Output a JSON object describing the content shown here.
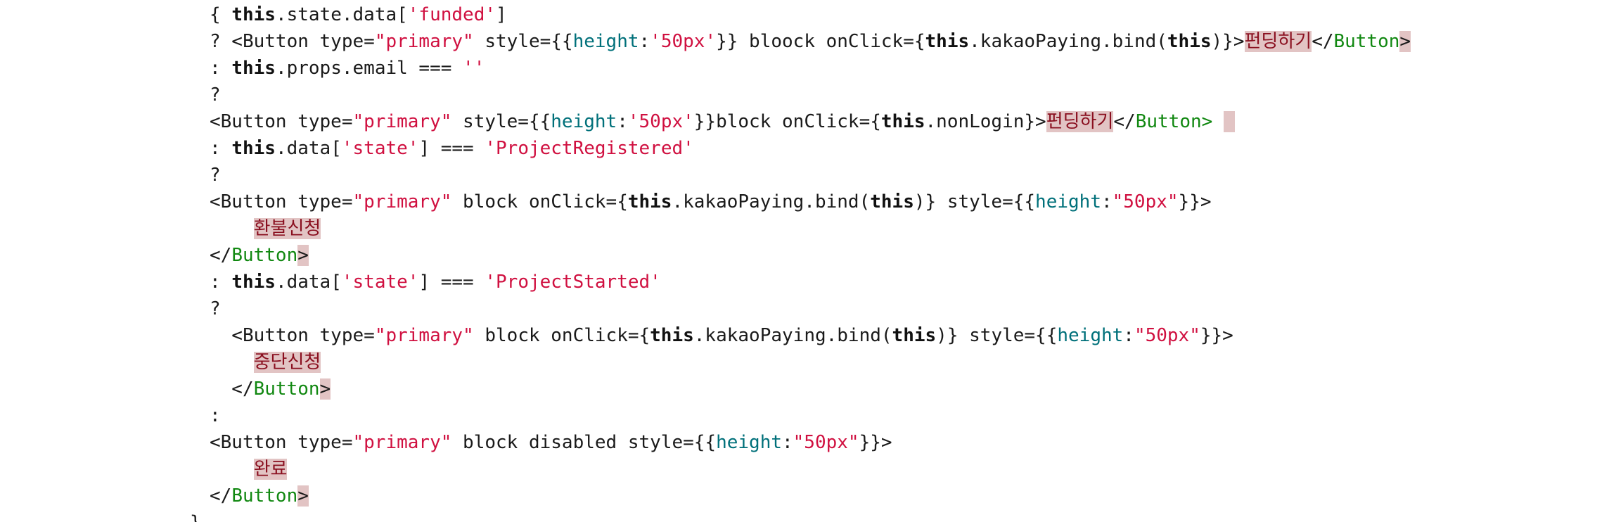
{
  "editor": {
    "colors": {
      "background": "#ffffff",
      "text": "#1a1a1a",
      "keyword": "#111111",
      "string": "#d01040",
      "attribute": "#00707a",
      "jsx_tag": "#118811",
      "highlight": "#e2c4c4"
    },
    "lines": [
      [
        {
          "t": "{ ",
          "c": "plain"
        },
        {
          "t": "this",
          "c": "kw"
        },
        {
          "t": ".state.data[",
          "c": "plain"
        },
        {
          "t": "'funded'",
          "c": "str"
        },
        {
          "t": "]",
          "c": "plain"
        }
      ],
      [
        {
          "t": "? <Button type=",
          "c": "plain"
        },
        {
          "t": "\"primary\"",
          "c": "str"
        },
        {
          "t": " style={{",
          "c": "plain"
        },
        {
          "t": "height",
          "c": "attr"
        },
        {
          "t": ":",
          "c": "plain"
        },
        {
          "t": "'50px'",
          "c": "str"
        },
        {
          "t": "}} bloock onClick={",
          "c": "plain"
        },
        {
          "t": "this",
          "c": "kw"
        },
        {
          "t": ".kakaoPaying.bind(",
          "c": "plain"
        },
        {
          "t": "this",
          "c": "kw"
        },
        {
          "t": ")}>",
          "c": "plain"
        },
        {
          "t": "펀딩하기",
          "c": "hl"
        },
        {
          "t": "</",
          "c": "plain"
        },
        {
          "t": "Button",
          "c": "tag"
        },
        {
          "t": ">",
          "c": "hl-plain"
        }
      ],
      [
        {
          "t": ": ",
          "c": "plain"
        },
        {
          "t": "this",
          "c": "kw"
        },
        {
          "t": ".props.email === ",
          "c": "plain"
        },
        {
          "t": "''",
          "c": "str"
        }
      ],
      [
        {
          "t": "?",
          "c": "plain"
        }
      ],
      [
        {
          "t": "<Button type=",
          "c": "plain"
        },
        {
          "t": "\"primary\"",
          "c": "str"
        },
        {
          "t": " style={{",
          "c": "plain"
        },
        {
          "t": "height",
          "c": "attr"
        },
        {
          "t": ":",
          "c": "plain"
        },
        {
          "t": "'50px'",
          "c": "str"
        },
        {
          "t": "}}block onClick={",
          "c": "plain"
        },
        {
          "t": "this",
          "c": "kw"
        },
        {
          "t": ".nonLogin}>",
          "c": "plain"
        },
        {
          "t": "펀딩하기",
          "c": "hl"
        },
        {
          "t": "</",
          "c": "plain"
        },
        {
          "t": "Button>",
          "c": "tag"
        },
        {
          "t": " ",
          "c": "plain"
        },
        {
          "t": " ",
          "c": "hl-plain"
        }
      ],
      [
        {
          "t": ": ",
          "c": "plain"
        },
        {
          "t": "this",
          "c": "kw"
        },
        {
          "t": ".data[",
          "c": "plain"
        },
        {
          "t": "'state'",
          "c": "str"
        },
        {
          "t": "] === ",
          "c": "plain"
        },
        {
          "t": "'ProjectRegistered'",
          "c": "str"
        }
      ],
      [
        {
          "t": "?",
          "c": "plain"
        }
      ],
      [
        {
          "t": "<Button type=",
          "c": "plain"
        },
        {
          "t": "\"primary\"",
          "c": "str"
        },
        {
          "t": " block onClick={",
          "c": "plain"
        },
        {
          "t": "this",
          "c": "kw"
        },
        {
          "t": ".kakaoPaying.bind(",
          "c": "plain"
        },
        {
          "t": "this",
          "c": "kw"
        },
        {
          "t": ")} style={{",
          "c": "plain"
        },
        {
          "t": "height",
          "c": "attr"
        },
        {
          "t": ":",
          "c": "plain"
        },
        {
          "t": "\"50px\"",
          "c": "str"
        },
        {
          "t": "}}>",
          "c": "plain"
        }
      ],
      [
        {
          "t": "    ",
          "c": "plain"
        },
        {
          "t": "환불신청",
          "c": "hl"
        }
      ],
      [
        {
          "t": "</",
          "c": "plain"
        },
        {
          "t": "Button",
          "c": "tag"
        },
        {
          "t": ">",
          "c": "hl-plain"
        }
      ],
      [
        {
          "t": ": ",
          "c": "plain"
        },
        {
          "t": "this",
          "c": "kw"
        },
        {
          "t": ".data[",
          "c": "plain"
        },
        {
          "t": "'state'",
          "c": "str"
        },
        {
          "t": "] === ",
          "c": "plain"
        },
        {
          "t": "'ProjectStarted'",
          "c": "str"
        }
      ],
      [
        {
          "t": "?",
          "c": "plain"
        }
      ],
      [
        {
          "t": "  <Button type=",
          "c": "plain"
        },
        {
          "t": "\"primary\"",
          "c": "str"
        },
        {
          "t": " block onClick={",
          "c": "plain"
        },
        {
          "t": "this",
          "c": "kw"
        },
        {
          "t": ".kakaoPaying.bind(",
          "c": "plain"
        },
        {
          "t": "this",
          "c": "kw"
        },
        {
          "t": ")} style={{",
          "c": "plain"
        },
        {
          "t": "height",
          "c": "attr"
        },
        {
          "t": ":",
          "c": "plain"
        },
        {
          "t": "\"50px\"",
          "c": "str"
        },
        {
          "t": "}}>",
          "c": "plain"
        }
      ],
      [
        {
          "t": "    ",
          "c": "plain"
        },
        {
          "t": "중단신청",
          "c": "hl"
        }
      ],
      [
        {
          "t": "  </",
          "c": "plain"
        },
        {
          "t": "Button",
          "c": "tag"
        },
        {
          "t": ">",
          "c": "hl-plain"
        }
      ],
      [
        {
          "t": ":",
          "c": "plain"
        }
      ],
      [
        {
          "t": "<Button type=",
          "c": "plain"
        },
        {
          "t": "\"primary\"",
          "c": "str"
        },
        {
          "t": " block disabled style={{",
          "c": "plain"
        },
        {
          "t": "height",
          "c": "attr"
        },
        {
          "t": ":",
          "c": "plain"
        },
        {
          "t": "\"50px\"",
          "c": "str"
        },
        {
          "t": "}}>",
          "c": "plain"
        }
      ],
      [
        {
          "t": "    ",
          "c": "plain"
        },
        {
          "t": "완료",
          "c": "hl"
        }
      ],
      [
        {
          "t": "</",
          "c": "plain"
        },
        {
          "t": "Button",
          "c": "tag"
        },
        {
          "t": ">",
          "c": "hl-plain"
        }
      ],
      [
        {
          "t": "}",
          "c": "plain"
        }
      ]
    ]
  }
}
